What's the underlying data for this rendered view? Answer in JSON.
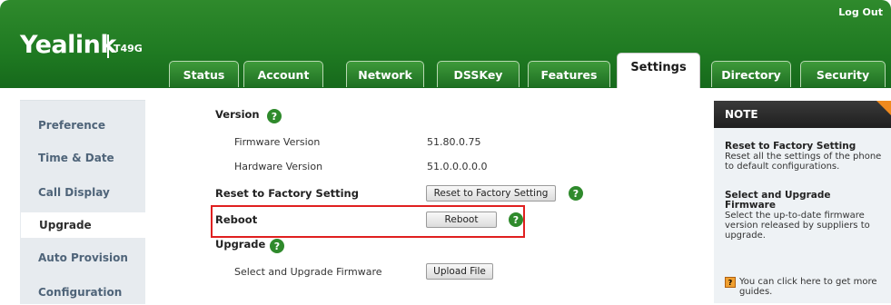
{
  "header": {
    "logo": "Yealink",
    "model": "T49G",
    "logout": "Log Out"
  },
  "tabs": [
    "Status",
    "Account",
    "Network",
    "DSSKey",
    "Features",
    "Settings",
    "Directory",
    "Security"
  ],
  "active_tab": "Settings",
  "sidebar": {
    "items": [
      "Preference",
      "Time & Date",
      "Call Display",
      "Upgrade",
      "Auto Provision",
      "Configuration"
    ],
    "active": "Upgrade"
  },
  "main": {
    "version_title": "Version",
    "firmware_label": "Firmware Version",
    "firmware_value": "51.80.0.75",
    "hardware_label": "Hardware Version",
    "hardware_value": "51.0.0.0.0.0",
    "reset_label": "Reset to Factory Setting",
    "reset_button": "Reset to Factory Setting",
    "reboot_label": "Reboot",
    "reboot_button": "Reboot",
    "upgrade_title": "Upgrade",
    "select_label": "Select and Upgrade Firmware",
    "upload_button": "Upload File",
    "help_glyph": "?"
  },
  "note": {
    "title": "NOTE",
    "reset_title": "Reset to Factory Setting",
    "reset_text": "Reset all the settings of the phone to default configurations.",
    "upgrade_title": "Select and Upgrade Firmware",
    "upgrade_text": "Select the up-to-date firmware version released by suppliers to upgrade.",
    "guide_text": "You can click here to get more guides."
  },
  "colors": {
    "header_green": "#1f7a22",
    "highlight_red": "#e02020",
    "note_accent": "#f08a1e"
  }
}
